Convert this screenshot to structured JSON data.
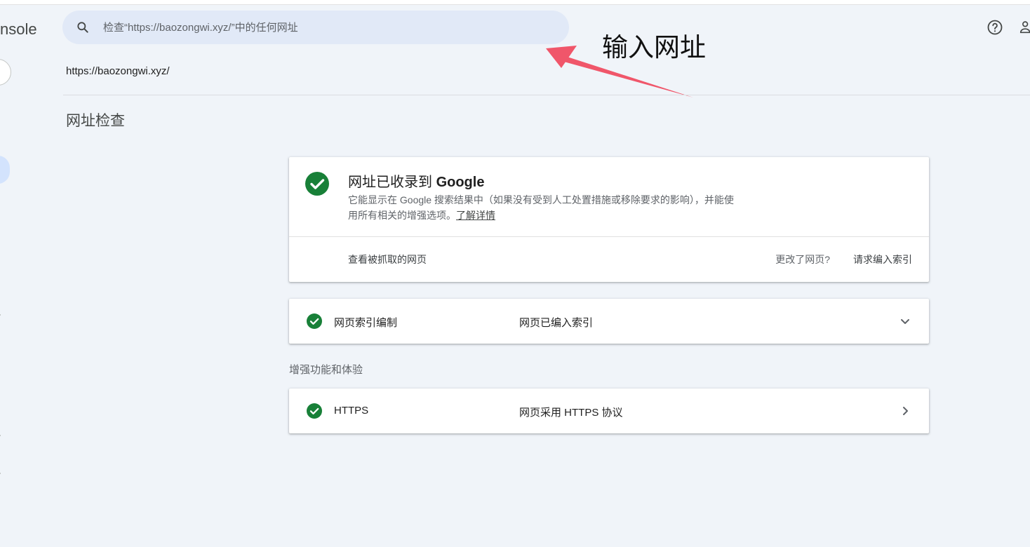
{
  "header": {
    "brand_fragment": "nsole",
    "search": {
      "placeholder": "检查“https://baozongwi.xyz/”中的任何网址",
      "value": ""
    },
    "icons": [
      "search-icon",
      "help-icon",
      "account-icon"
    ]
  },
  "annotation": {
    "text": "输入网址"
  },
  "inspection": {
    "url": "https://baozongwi.xyz/",
    "page_title": "网址检查"
  },
  "status_card": {
    "title_prefix": "网址已收录到 ",
    "title_brand": "Google",
    "description": "它能显示在 Google 搜索结果中（如果没有受到人工处置措施或移除要求的影响），并能使用所有相关的增强选项。",
    "learn_more": "了解详情",
    "view_crawled": "查看被抓取的网页",
    "changed_question": "更改了网页?",
    "request_indexing": "请求编入索引"
  },
  "indexing_row": {
    "label": "网页索引编制",
    "status": "网页已编入索引"
  },
  "enhancements": {
    "heading": "增强功能和体验",
    "rows": [
      {
        "label": "HTTPS",
        "status": "网页采用 HTTPS 协议"
      }
    ]
  },
  "colors": {
    "background": "#f0f4f9",
    "search_bg": "#e1e9f7",
    "success_green": "#188038",
    "annotation_arrow": "#f0566a"
  }
}
